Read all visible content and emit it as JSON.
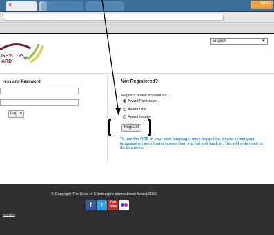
{
  "browser": {
    "active_tab_close": "✕",
    "extension_label": "Opera"
  },
  "header": {
    "logo_text_line1": "GH'S",
    "logo_text_line2": "ARD",
    "language_selected": "English"
  },
  "login": {
    "heading": "ress and Password.",
    "button": "Log In"
  },
  "register": {
    "title": "Not Registered?",
    "prompt": "Register a new account as:",
    "options": [
      {
        "label": "Award Participant",
        "selected": true
      },
      {
        "label": "Award Unit",
        "selected": false
      },
      {
        "label": "Award Leader",
        "selected": false
      }
    ],
    "button": "Register",
    "info": "To use the ORB in your own language, once logged in; please select your language on your home screen then log out and back in. You will only need to do this once."
  },
  "footer": {
    "copyright_prefix": "© Copyright ",
    "copyright_link": "The Duke of Edinburgh's International Award",
    "copyright_year": " 2015",
    "privacy": "cy Policy"
  },
  "social": {
    "facebook": "f",
    "twitter": "t",
    "youtube": "You Tube"
  },
  "colors": {
    "link_blue": "#2a86c7",
    "footer_bg": "#2f2f2f",
    "logo_maroon": "#6e1b3a"
  }
}
